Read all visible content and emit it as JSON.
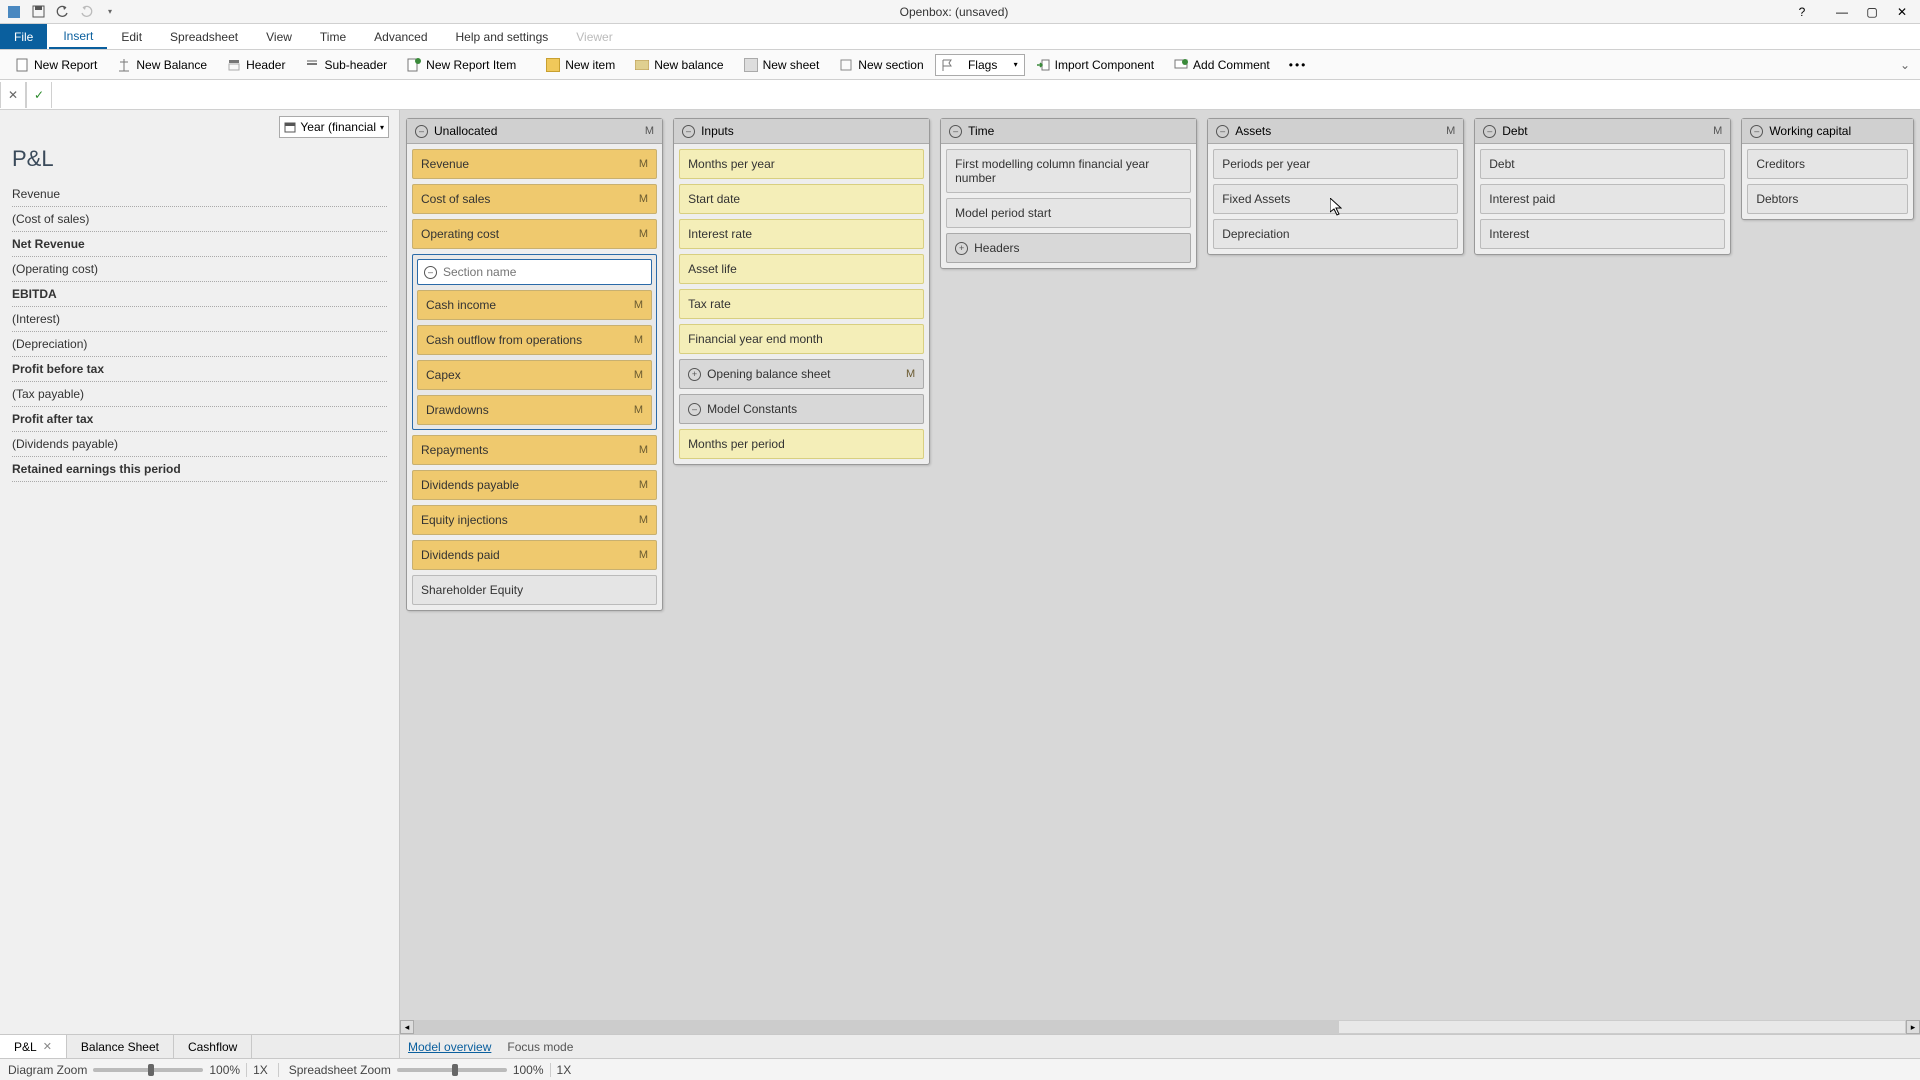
{
  "window": {
    "title": "Openbox:  (unsaved)"
  },
  "menu": {
    "file": "File",
    "insert": "Insert",
    "edit": "Edit",
    "spreadsheet": "Spreadsheet",
    "view": "View",
    "time": "Time",
    "advanced": "Advanced",
    "help": "Help and settings",
    "viewer": "Viewer"
  },
  "toolbar": {
    "new_report": "New Report",
    "new_balance": "New Balance",
    "header": "Header",
    "sub_header": "Sub-header",
    "new_report_item": "New Report Item",
    "new_item": "New item",
    "new_balance2": "New balance",
    "new_sheet": "New sheet",
    "new_section": "New section",
    "flags": "Flags",
    "import_component": "Import Component",
    "add_comment": "Add Comment"
  },
  "year_selector": "Year (financial",
  "pl": {
    "title": "P&L",
    "rows": [
      {
        "label": "Revenue",
        "bold": false
      },
      {
        "label": "(Cost of sales)",
        "bold": false
      },
      {
        "label": "Net Revenue",
        "bold": true
      },
      {
        "label": "(Operating cost)",
        "bold": false
      },
      {
        "label": "EBITDA",
        "bold": true
      },
      {
        "label": "(Interest)",
        "bold": false
      },
      {
        "label": "(Depreciation)",
        "bold": false
      },
      {
        "label": "Profit before tax",
        "bold": true
      },
      {
        "label": "(Tax payable)",
        "bold": false
      },
      {
        "label": "Profit after tax",
        "bold": true
      },
      {
        "label": "(Dividends payable)",
        "bold": false
      },
      {
        "label": "Retained earnings this period",
        "bold": true
      }
    ]
  },
  "cards": {
    "unallocated": {
      "title": "Unallocated",
      "m": "M",
      "items_top": [
        {
          "label": "Revenue",
          "m": "M"
        },
        {
          "label": "Cost of sales",
          "m": "M"
        },
        {
          "label": "Operating cost",
          "m": "M"
        }
      ],
      "section_placeholder": "Section name",
      "section_items": [
        {
          "label": "Cash income",
          "m": "M"
        },
        {
          "label": "Cash outflow from operations",
          "m": "M"
        },
        {
          "label": "Capex",
          "m": "M"
        },
        {
          "label": "Drawdowns",
          "m": "M"
        }
      ],
      "items_after": [
        {
          "label": "Repayments",
          "m": "M"
        },
        {
          "label": "Dividends payable",
          "m": "M"
        },
        {
          "label": "Equity injections",
          "m": "M"
        },
        {
          "label": "Dividends paid",
          "m": "M"
        }
      ],
      "last": "Shareholder Equity"
    },
    "inputs": {
      "title": "Inputs",
      "items": [
        "Months per year",
        "Start date",
        "Interest rate",
        "Asset life",
        "Tax rate",
        "Financial year end month"
      ],
      "sub1": {
        "label": "Opening balance sheet",
        "m": "M"
      },
      "sub2": {
        "label": "Model Constants"
      },
      "after": "Months per period"
    },
    "time": {
      "title": "Time",
      "items": [
        "First modelling column financial year number",
        "Model period start"
      ],
      "sub": "Headers"
    },
    "assets": {
      "title": "Assets",
      "m": "M",
      "items": [
        "Periods per year",
        "Fixed Assets",
        "Depreciation"
      ]
    },
    "debt": {
      "title": "Debt",
      "m": "M",
      "items": [
        "Debt",
        "Interest paid",
        "Interest"
      ]
    },
    "wc": {
      "title": "Working capital",
      "items": [
        "Creditors",
        "Debtors"
      ]
    }
  },
  "bottom_tabs": {
    "pl": "P&L",
    "bs": "Balance Sheet",
    "cf": "Cashflow"
  },
  "views": {
    "overview": "Model overview",
    "focus": "Focus mode"
  },
  "status": {
    "diagram_zoom": "Diagram Zoom",
    "diagram_pct": "100%",
    "diagram_x": "1X",
    "sheet_zoom": "Spreadsheet Zoom",
    "sheet_pct": "100%",
    "sheet_x": "1X"
  }
}
